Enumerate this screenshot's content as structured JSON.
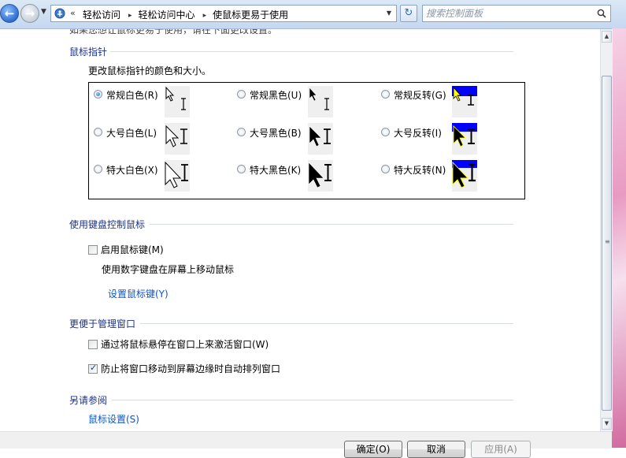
{
  "address_bar": {
    "overflow_chevron": "«",
    "breadcrumbs": [
      "轻松访问",
      "轻松访问中心",
      "使鼠标更易于使用"
    ],
    "separator": "▸",
    "search_placeholder": "搜索控制面板"
  },
  "content": {
    "cutoff_text": "如果您想让鼠标更易于使用，请在下面更改设置。",
    "pointers": {
      "title": "鼠标指针",
      "description": "更改鼠标指针的颜色和大小。",
      "selected": "常规白色",
      "options": [
        {
          "label": "常规白色(R)",
          "style": "white",
          "size": "regular",
          "checked": true
        },
        {
          "label": "常规黑色(U)",
          "style": "black",
          "size": "regular",
          "checked": false
        },
        {
          "label": "常规反转(G)",
          "style": "inverted",
          "size": "regular",
          "checked": false
        },
        {
          "label": "大号白色(L)",
          "style": "white",
          "size": "large",
          "checked": false
        },
        {
          "label": "大号黑色(B)",
          "style": "black",
          "size": "large",
          "checked": false
        },
        {
          "label": "大号反转(I)",
          "style": "inverted",
          "size": "large",
          "checked": false
        },
        {
          "label": "特大白色(X)",
          "style": "white",
          "size": "extra",
          "checked": false
        },
        {
          "label": "特大黑色(K)",
          "style": "black",
          "size": "extra",
          "checked": false
        },
        {
          "label": "特大反转(N)",
          "style": "inverted",
          "size": "extra",
          "checked": false
        }
      ]
    },
    "keyboard": {
      "title": "使用键盘控制鼠标",
      "checkbox_label": "启用鼠标键(M)",
      "checked": false,
      "description": "使用数字键盘在屏幕上移动鼠标",
      "link": "设置鼠标键(Y)"
    },
    "windows": {
      "title": "更便于管理窗口",
      "options": [
        {
          "label": "通过将鼠标悬停在窗口上来激活窗口(W)",
          "checked": false
        },
        {
          "label": "防止将窗口移动到屏幕边缘时自动排列窗口",
          "checked": true
        }
      ]
    },
    "see_also": {
      "title": "另请参阅",
      "link": "鼠标设置(S)"
    }
  },
  "buttons": {
    "ok": "确定(O)",
    "cancel": "取消",
    "apply": "应用(A)"
  },
  "colors": {
    "section_title": "#1e3287",
    "link": "#0a56c7",
    "inverted_bg": "#0000ff",
    "inverted_cursor": "#ffff00"
  }
}
